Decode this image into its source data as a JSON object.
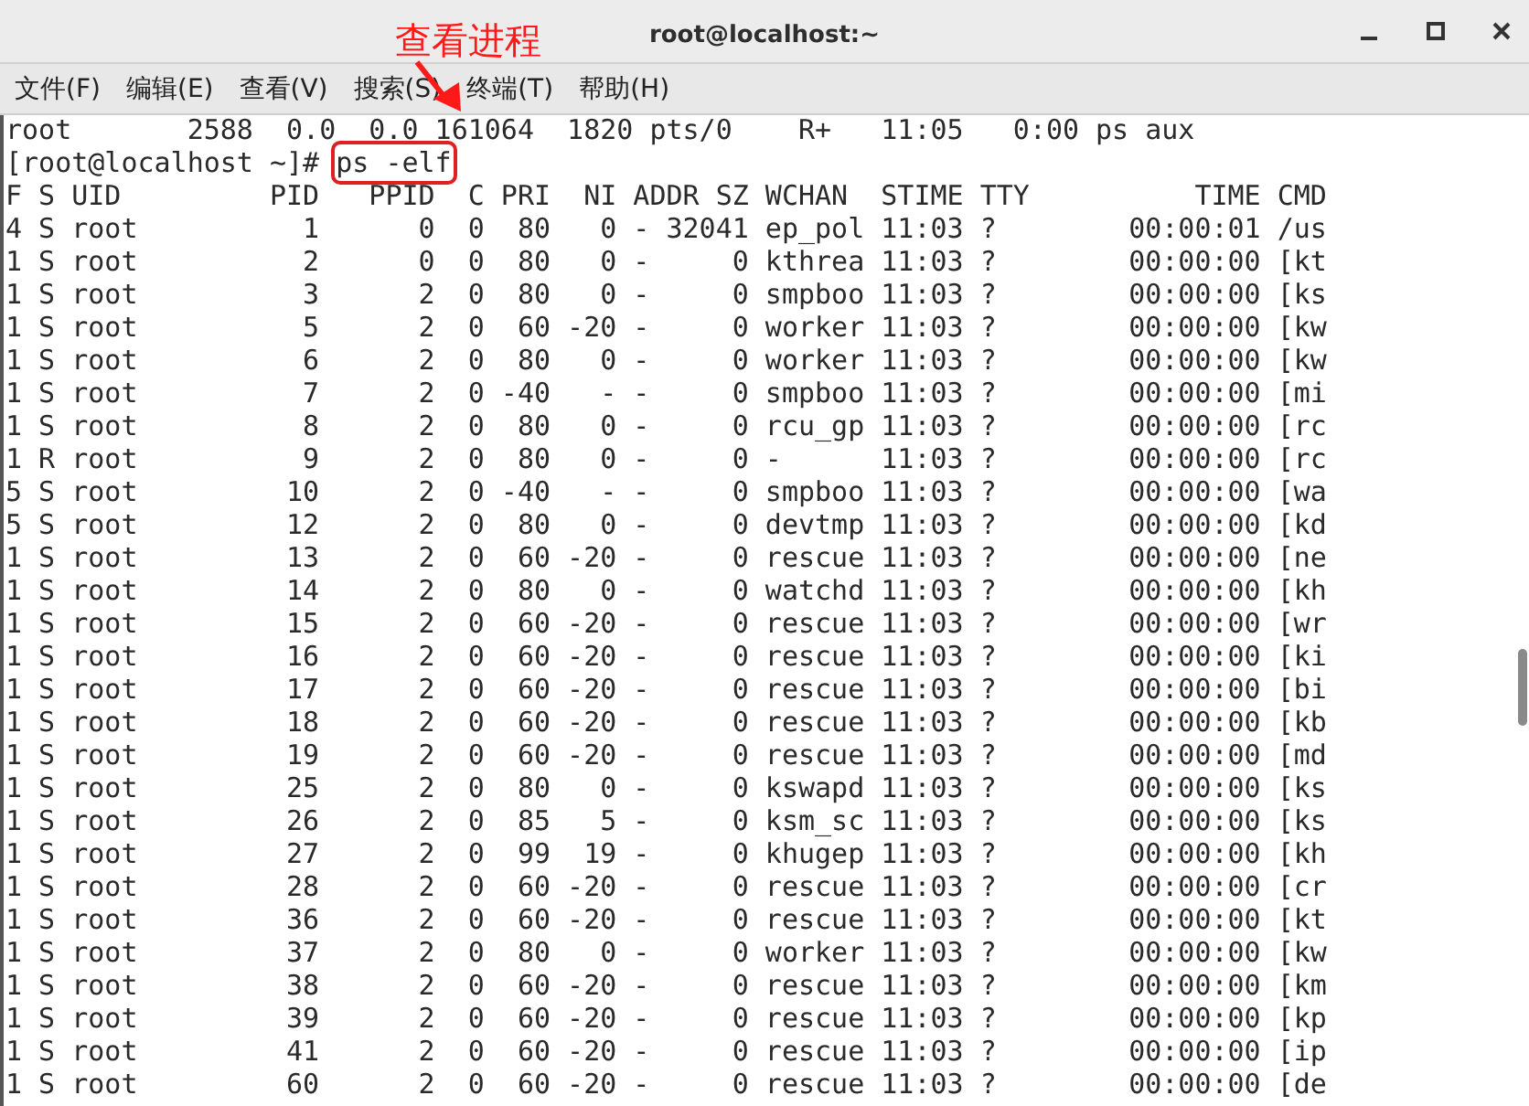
{
  "window": {
    "title": "root@localhost:~"
  },
  "annotation": {
    "label": "查看进程"
  },
  "menu": [
    "文件(F)",
    "编辑(E)",
    "查看(V)",
    "搜索(S)",
    "终端(T)",
    "帮助(H)"
  ],
  "terminal": {
    "previous_line": "root       2588  0.0  0.0 161064  1820 pts/0    R+   11:05   0:00 ps aux",
    "prompt": "[root@localhost ~]# ",
    "command": "ps -elf",
    "header": "F S UID         PID   PPID  C PRI  NI ADDR SZ WCHAN  STIME TTY          TIME CMD",
    "lines": [
      "4 S root          1      0  0  80   0 - 32041 ep_pol 11:03 ?        00:00:01 /us",
      "1 S root          2      0  0  80   0 -     0 kthrea 11:03 ?        00:00:00 [kt",
      "1 S root          3      2  0  80   0 -     0 smpboo 11:03 ?        00:00:00 [ks",
      "1 S root          5      2  0  60 -20 -     0 worker 11:03 ?        00:00:00 [kw",
      "1 S root          6      2  0  80   0 -     0 worker 11:03 ?        00:00:00 [kw",
      "1 S root          7      2  0 -40   - -     0 smpboo 11:03 ?        00:00:00 [mi",
      "1 S root          8      2  0  80   0 -     0 rcu_gp 11:03 ?        00:00:00 [rc",
      "1 R root          9      2  0  80   0 -     0 -      11:03 ?        00:00:00 [rc",
      "5 S root         10      2  0 -40   - -     0 smpboo 11:03 ?        00:00:00 [wa",
      "5 S root         12      2  0  80   0 -     0 devtmp 11:03 ?        00:00:00 [kd",
      "1 S root         13      2  0  60 -20 -     0 rescue 11:03 ?        00:00:00 [ne",
      "1 S root         14      2  0  80   0 -     0 watchd 11:03 ?        00:00:00 [kh",
      "1 S root         15      2  0  60 -20 -     0 rescue 11:03 ?        00:00:00 [wr",
      "1 S root         16      2  0  60 -20 -     0 rescue 11:03 ?        00:00:00 [ki",
      "1 S root         17      2  0  60 -20 -     0 rescue 11:03 ?        00:00:00 [bi",
      "1 S root         18      2  0  60 -20 -     0 rescue 11:03 ?        00:00:00 [kb",
      "1 S root         19      2  0  60 -20 -     0 rescue 11:03 ?        00:00:00 [md",
      "1 S root         25      2  0  80   0 -     0 kswapd 11:03 ?        00:00:00 [ks",
      "1 S root         26      2  0  85   5 -     0 ksm_sc 11:03 ?        00:00:00 [ks",
      "1 S root         27      2  0  99  19 -     0 khugep 11:03 ?        00:00:00 [kh",
      "1 S root         28      2  0  60 -20 -     0 rescue 11:03 ?        00:00:00 [cr",
      "1 S root         36      2  0  60 -20 -     0 rescue 11:03 ?        00:00:00 [kt",
      "1 S root         37      2  0  80   0 -     0 worker 11:03 ?        00:00:00 [kw",
      "1 S root         38      2  0  60 -20 -     0 rescue 11:03 ?        00:00:00 [km",
      "1 S root         39      2  0  60 -20 -     0 rescue 11:03 ?        00:00:00 [kp",
      "1 S root         41      2  0  60 -20 -     0 rescue 11:03 ?        00:00:00 [ip",
      "1 S root         60      2  0  60 -20 -     0 rescue 11:03 ?        00:00:00 [de"
    ]
  }
}
